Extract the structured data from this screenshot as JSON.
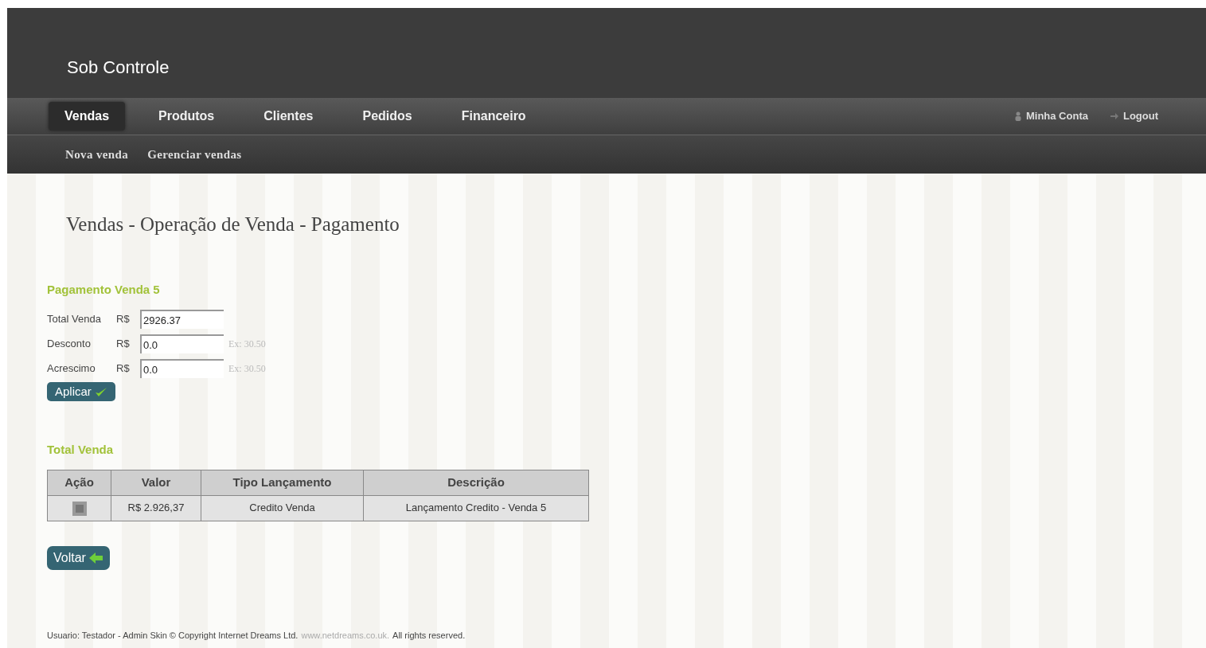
{
  "brand": "Sob Controle",
  "nav": [
    {
      "label": "Vendas",
      "selected": true
    },
    {
      "label": "Produtos",
      "selected": false
    },
    {
      "label": "Clientes",
      "selected": false
    },
    {
      "label": "Pedidos",
      "selected": false
    },
    {
      "label": "Financeiro",
      "selected": false
    }
  ],
  "account_links": [
    {
      "kind": "account",
      "label": "Minha Conta"
    },
    {
      "kind": "logout",
      "label": "Logout"
    }
  ],
  "subnav": [
    "Nova venda",
    "Gerenciar vendas"
  ],
  "page_title": "Vendas - Operação de Venda - Pagamento",
  "payment": {
    "heading": "Pagamento Venda 5",
    "fields": [
      {
        "label": "Total Venda",
        "currency": "R$",
        "value": "2926.37"
      },
      {
        "label": "Desconto",
        "currency": "R$",
        "value": "0.0",
        "hint": "Ex: 30.50"
      },
      {
        "label": "Acrescimo",
        "currency": "R$",
        "value": "0.0",
        "hint": "Ex: 30.50"
      }
    ],
    "apply_button": "Aplicar"
  },
  "total": {
    "heading": "Total Venda",
    "columns": [
      "Ação",
      "Valor",
      "Tipo Lançamento",
      "Descrição"
    ],
    "rows": [
      {
        "value": "R$ 2.926,37",
        "type": "Credito Venda",
        "description": "Lançamento Credito - Venda 5"
      }
    ]
  },
  "back_button": "Voltar",
  "footer": {
    "text": "Usuario: Testador - Admin Skin © Copyright Internet Dreams Ltd.",
    "link": "www.netdreams.co.uk.",
    "rights": "All rights reserved."
  }
}
